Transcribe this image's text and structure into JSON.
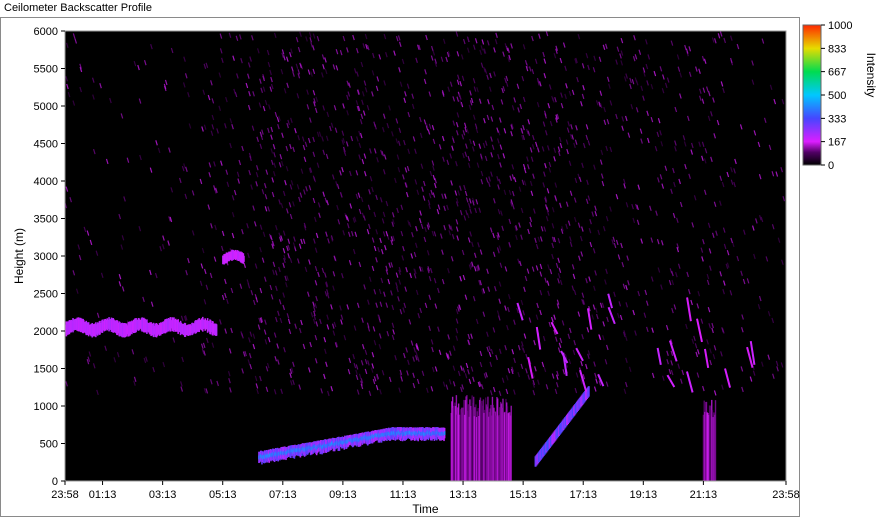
{
  "window": {
    "title": "Ceilometer Backscatter Profile"
  },
  "colors": {
    "background": "#000000",
    "low": "#550066",
    "mid": "#cc22ff",
    "high": "#3399ff"
  },
  "chart_data": {
    "type": "heatmap",
    "title": "Ceilometer Backscatter Profile",
    "xlabel": "Time",
    "ylabel": "Height (m)",
    "x_ticks": [
      "23:58",
      "01:13",
      "03:13",
      "05:13",
      "07:13",
      "09:13",
      "11:13",
      "13:13",
      "15:13",
      "17:13",
      "19:13",
      "21:13",
      "23:58"
    ],
    "x_tick_hours": [
      23.97,
      25.22,
      27.22,
      29.22,
      31.22,
      33.22,
      35.22,
      37.22,
      39.22,
      41.22,
      43.22,
      45.22,
      47.97
    ],
    "xlim": [
      23.97,
      47.97
    ],
    "y_ticks": [
      0,
      500,
      1000,
      1500,
      2000,
      2500,
      3000,
      3500,
      4000,
      4500,
      5000,
      5500,
      6000
    ],
    "ylim": [
      0,
      6000
    ],
    "colorbar": {
      "label": "Intensity",
      "ticks": [
        "1000",
        "833",
        "667",
        "500",
        "333",
        "167",
        "0"
      ],
      "range": [
        0,
        1000
      ]
    },
    "features": [
      {
        "kind": "cloud_layer",
        "time_start": 23.97,
        "time_end": 29.0,
        "height_low": 1950,
        "height_high": 2150,
        "intensity": 180
      },
      {
        "kind": "cloud_layer",
        "time_start": 29.2,
        "time_end": 29.9,
        "height_low": 2900,
        "height_high": 3050,
        "intensity": 170
      },
      {
        "kind": "boundary_layer",
        "time_start": 30.4,
        "time_end": 36.6,
        "height_low": 400,
        "height_high": 720,
        "intensity": 360
      },
      {
        "kind": "precipitation",
        "time_start": 36.8,
        "time_end": 38.8,
        "height_low": 0,
        "height_high": 1150,
        "intensity": 140
      },
      {
        "kind": "precipitation",
        "time_start": 45.2,
        "time_end": 45.6,
        "height_low": 0,
        "height_high": 1150,
        "intensity": 150
      },
      {
        "kind": "rising_layer",
        "time_start": 39.6,
        "time_end": 41.4,
        "height_low": 250,
        "height_high": 1200,
        "intensity": 200
      },
      {
        "kind": "scattered_clouds",
        "time_start": 38.0,
        "time_end": 47.0,
        "height_low": 1400,
        "height_high": 2500,
        "intensity": 160
      }
    ]
  }
}
